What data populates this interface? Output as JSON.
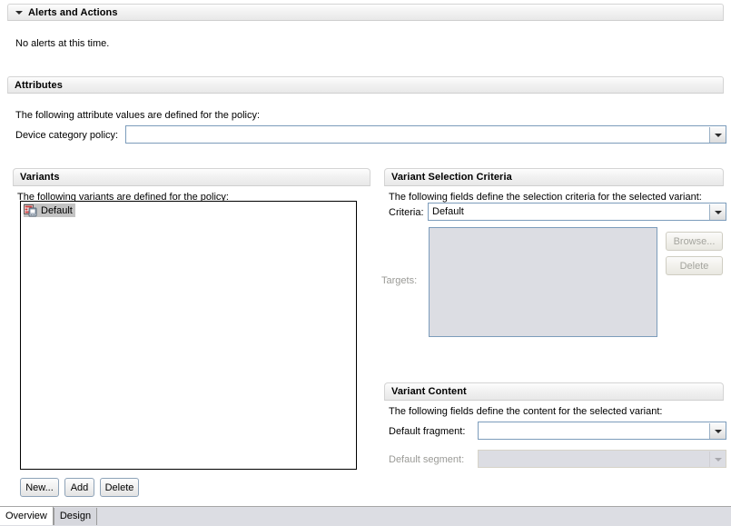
{
  "sections": {
    "alerts": {
      "title": "Alerts and Actions",
      "collapsed_icon": "triangle-down-icon",
      "message": "No alerts at this time."
    },
    "attributes": {
      "title": "Attributes",
      "description": "The following attribute values are defined for the policy:",
      "device_category_label": "Device category policy:",
      "device_category_value": "",
      "device_category_placeholder": ""
    },
    "variants": {
      "title": "Variants",
      "description": "The following variants are defined for the policy:",
      "items": [
        {
          "label": "Default",
          "icon": "variant-device-icon",
          "selected": true
        }
      ],
      "buttons": [
        {
          "label": "New...",
          "name": "new-variant-button",
          "enabled": true
        },
        {
          "label": "Add",
          "name": "add-variant-button",
          "enabled": true
        },
        {
          "label": "Delete",
          "name": "delete-variant-button",
          "enabled": true
        }
      ]
    },
    "variant_selection_criteria": {
      "title": "Variant Selection Criteria",
      "description": "The following fields define the selection criteria for the selected variant:",
      "criteria_label": "Criteria:",
      "criteria_value": "Default",
      "targets_label": "Targets:",
      "targets_value": "",
      "browse_label": "Browse...",
      "delete_label": "Delete"
    },
    "variant_content": {
      "title": "Variant Content",
      "description": "The following fields define the content for the selected variant:",
      "default_fragment_label": "Default fragment:",
      "default_fragment_value": "",
      "default_segment_label": "Default segment:",
      "default_segment_value": ""
    }
  },
  "tabs": [
    {
      "label": "Overview",
      "active": true
    },
    {
      "label": "Design",
      "active": false
    }
  ],
  "colors": {
    "panel_header_start": "#fdfdfd",
    "panel_header_end": "#e8e8e8",
    "field_border": "#7c9cbb",
    "disabled_text": "#9a9a96",
    "disabled_fill": "#dcdde3",
    "selection_fill": "#c3c3c3",
    "tabbar_bg": "#dcdde3"
  }
}
